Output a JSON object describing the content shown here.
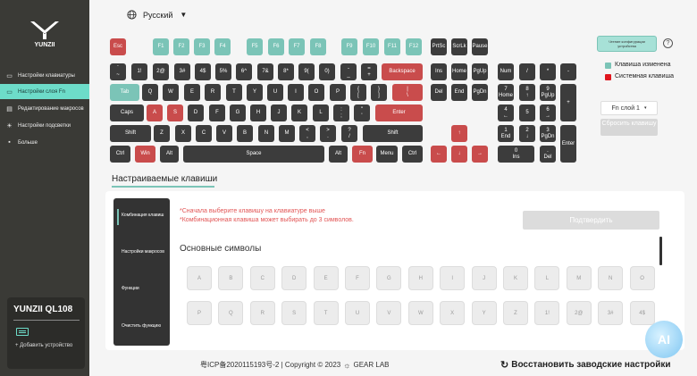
{
  "sidebar": {
    "logo_text": "YUNZII",
    "items": [
      {
        "label": "Настройки клавиатуры",
        "icon": "keyboard-icon"
      },
      {
        "label": "Настройки слоя Fn",
        "icon": "layers-icon"
      },
      {
        "label": "Редактирование макросов",
        "icon": "macro-icon"
      },
      {
        "label": "Настройки подсветки",
        "icon": "lightbulb-icon"
      },
      {
        "label": "Больше",
        "icon": "more-icon"
      }
    ],
    "active_index": 1,
    "device_name": "YUNZII QL108",
    "add_device": "+ Добавить устройство"
  },
  "language": {
    "label": "Русский",
    "icon": "globe-icon"
  },
  "keys": [
    {
      "t": "Esc",
      "c": "red"
    },
    {
      "t": "F1",
      "c": "teal"
    },
    {
      "t": "F2",
      "c": "teal"
    },
    {
      "t": "F3",
      "c": "teal"
    },
    {
      "t": "F4",
      "c": "teal"
    },
    {
      "t": "F5",
      "c": "teal"
    },
    {
      "t": "F6",
      "c": "teal"
    },
    {
      "t": "F7",
      "c": "teal"
    },
    {
      "t": "F8",
      "c": "teal"
    },
    {
      "t": "F9",
      "c": "teal"
    },
    {
      "t": "F10",
      "c": "teal"
    },
    {
      "t": "F11",
      "c": "teal"
    },
    {
      "t": "F12",
      "c": "teal"
    },
    {
      "t": "PrtSc"
    },
    {
      "t": "ScrLk"
    },
    {
      "t": "Pause"
    },
    {
      "t": "`\n~"
    },
    {
      "t": "1!"
    },
    {
      "t": "2@"
    },
    {
      "t": "3#"
    },
    {
      "t": "4$"
    },
    {
      "t": "5%"
    },
    {
      "t": "6^"
    },
    {
      "t": "7&"
    },
    {
      "t": "8*"
    },
    {
      "t": "9("
    },
    {
      "t": "0)"
    },
    {
      "t": "-\n_"
    },
    {
      "t": "=\n+"
    },
    {
      "t": "Backspace",
      "c": "red"
    },
    {
      "t": "Ins"
    },
    {
      "t": "Home"
    },
    {
      "t": "PgUp"
    },
    {
      "t": "Num"
    },
    {
      "t": "/"
    },
    {
      "t": "*"
    },
    {
      "t": "-"
    },
    {
      "t": "Tab",
      "c": "teal"
    },
    {
      "t": "Q"
    },
    {
      "t": "W"
    },
    {
      "t": "E"
    },
    {
      "t": "R"
    },
    {
      "t": "T"
    },
    {
      "t": "Y"
    },
    {
      "t": "U"
    },
    {
      "t": "I"
    },
    {
      "t": "O"
    },
    {
      "t": "P"
    },
    {
      "t": "{\n["
    },
    {
      "t": "}\n]"
    },
    {
      "t": "|\n\\",
      "c": "red"
    },
    {
      "t": "Del"
    },
    {
      "t": "End"
    },
    {
      "t": "PgDn"
    },
    {
      "t": "7\nHome"
    },
    {
      "t": "8\n↑"
    },
    {
      "t": "9\nPgUp"
    },
    {
      "t": "+"
    },
    {
      "t": "Caps"
    },
    {
      "t": "A",
      "c": "red"
    },
    {
      "t": "S",
      "c": "red"
    },
    {
      "t": "D"
    },
    {
      "t": "F"
    },
    {
      "t": "G"
    },
    {
      "t": "H"
    },
    {
      "t": "J"
    },
    {
      "t": "K"
    },
    {
      "t": "L"
    },
    {
      "t": ":\n;"
    },
    {
      "t": "\"\n'"
    },
    {
      "t": "Enter",
      "c": "red"
    },
    {
      "t": "4\n←"
    },
    {
      "t": "5"
    },
    {
      "t": "6\n→"
    },
    {
      "t": "Shift"
    },
    {
      "t": "Z"
    },
    {
      "t": "X"
    },
    {
      "t": "C"
    },
    {
      "t": "V"
    },
    {
      "t": "B"
    },
    {
      "t": "N"
    },
    {
      "t": "M"
    },
    {
      "t": "<\n,"
    },
    {
      "t": ">\n."
    },
    {
      "t": "?\n/"
    },
    {
      "t": "Shift"
    },
    {
      "t": "↑",
      "c": "red"
    },
    {
      "t": "1\nEnd"
    },
    {
      "t": "2\n↓"
    },
    {
      "t": "3\nPgDn"
    },
    {
      "t": "Enter"
    },
    {
      "t": "Ctrl"
    },
    {
      "t": "Win",
      "c": "red"
    },
    {
      "t": "Alt"
    },
    {
      "t": "Space"
    },
    {
      "t": "Alt"
    },
    {
      "t": "Fn",
      "c": "red"
    },
    {
      "t": "Menu"
    },
    {
      "t": "Ctrl"
    },
    {
      "t": "←",
      "c": "red"
    },
    {
      "t": "↓",
      "c": "red"
    },
    {
      "t": "→",
      "c": "red"
    },
    {
      "t": "0\nIns"
    },
    {
      "t": ".\nDel"
    }
  ],
  "update_button": "Чтение конфигурации устройства",
  "legend": {
    "changed": "Клавиша изменена",
    "system": "Системная клавиша"
  },
  "fn_layer": {
    "selected": "Fn слой 1",
    "reset_label": "Сбросить клавишу"
  },
  "config_tab": "Настраиваемые клавиши",
  "categories": [
    "Комбинация клавиш",
    "Настройки макросов",
    "Функции",
    "Очистить функцию"
  ],
  "hints": [
    "*Сначала выберите клавишу на клавиатуре выше",
    "*Комбинационная клавиша может выбирать до 3 символов."
  ],
  "confirm_label": "Подтвердить",
  "symbols_title": "Основные символы",
  "symbols_row1": [
    "A",
    "B",
    "C",
    "D",
    "E",
    "F",
    "G",
    "H",
    "I",
    "J",
    "K",
    "L",
    "M",
    "N",
    "O"
  ],
  "symbols_row2": [
    "P",
    "Q",
    "R",
    "S",
    "T",
    "U",
    "V",
    "W",
    "X",
    "Y",
    "Z",
    "1!",
    "2@",
    "3#",
    "4$"
  ],
  "footer": {
    "icp": "粤ICP备2020115193号-2 | Copyright © 2023",
    "brand": "GEAR LAB",
    "factory_reset": "Восстановить заводские настройки"
  },
  "colors": {
    "accent": "#7bc4b7",
    "system": "#c94c4c",
    "sidebar": "#3a3a36"
  }
}
